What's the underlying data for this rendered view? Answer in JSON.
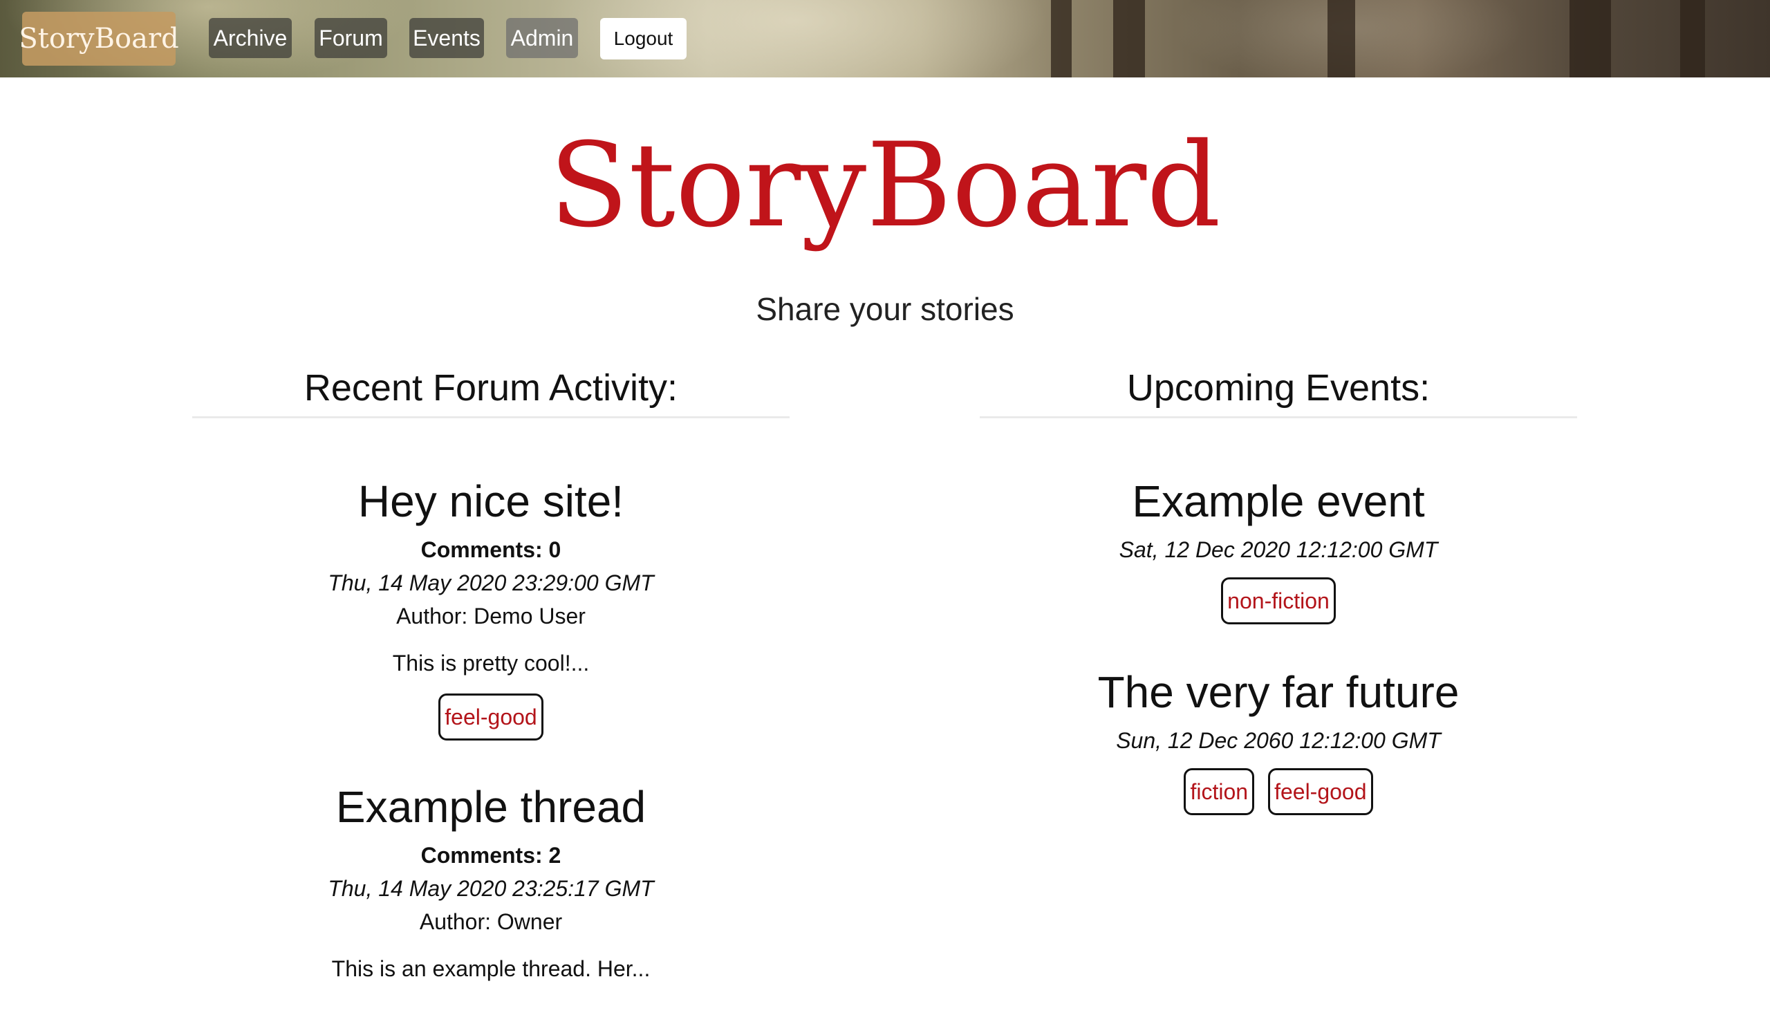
{
  "nav": {
    "brand": "StoryBoard",
    "links": [
      "Archive",
      "Forum",
      "Events",
      "Admin"
    ],
    "logout": "Logout"
  },
  "hero": {
    "title": "StoryBoard",
    "tagline": "Share your stories"
  },
  "forum": {
    "heading": "Recent Forum Activity:",
    "threads": [
      {
        "title": "Hey nice site!",
        "comments": "Comments: 0",
        "date": "Thu, 14 May 2020 23:29:00 GMT",
        "author": "Author: Demo User",
        "excerpt": "This is pretty cool!...",
        "tags": [
          "feel-good"
        ]
      },
      {
        "title": "Example thread",
        "comments": "Comments: 2",
        "date": "Thu, 14 May 2020 23:25:17 GMT",
        "author": "Author: Owner",
        "excerpt": "This is an example thread. Her..."
      }
    ]
  },
  "events": {
    "heading": "Upcoming Events:",
    "items": [
      {
        "title": "Example event",
        "date": "Sat, 12 Dec 2020 12:12:00 GMT",
        "tags": [
          "non-fiction"
        ]
      },
      {
        "title": "The very far future",
        "date": "Sun, 12 Dec 2060 12:12:00 GMT",
        "tags": [
          "fiction",
          "feel-good"
        ]
      }
    ]
  },
  "colors": {
    "accent": "#c0141a",
    "tag_text": "#b3141a",
    "brand_bg": "#c49b62"
  }
}
